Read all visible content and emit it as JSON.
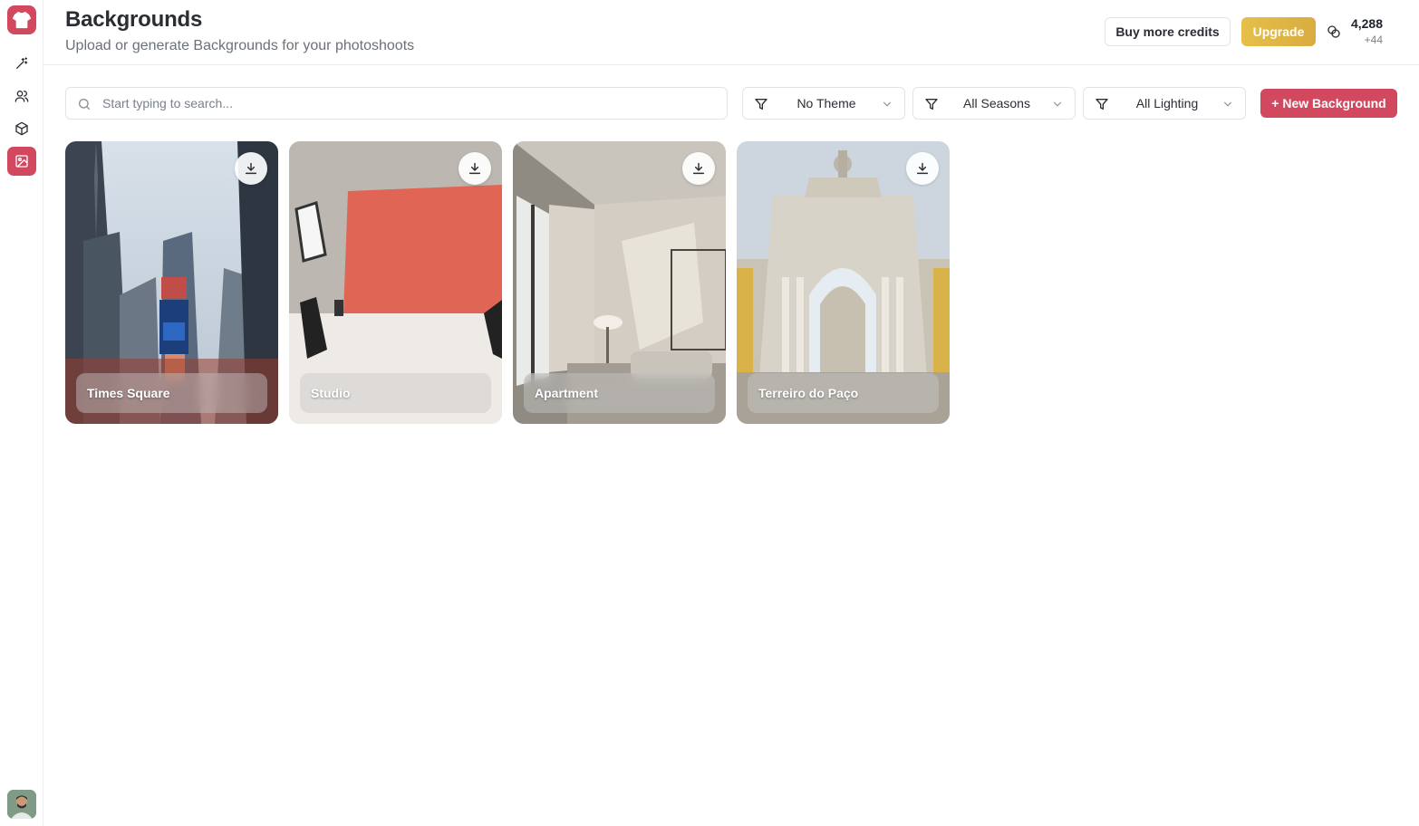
{
  "sidebar": {
    "logo": "shirt-logo-icon",
    "items": [
      {
        "icon": "magic-wand-icon",
        "active": false
      },
      {
        "icon": "users-icon",
        "active": false
      },
      {
        "icon": "box-icon",
        "active": false
      },
      {
        "icon": "image-icon",
        "active": true
      }
    ],
    "avatar": "user-avatar"
  },
  "header": {
    "title": "Backgrounds",
    "subtitle": "Upload or generate Backgrounds for your photoshoots",
    "buy_credits_label": "Buy more credits",
    "upgrade_label": "Upgrade",
    "credits_total": "4,288",
    "credits_delta": "+44"
  },
  "toolbar": {
    "search_placeholder": "Start typing to search...",
    "search_value": "",
    "filters": [
      {
        "icon": "filter-icon",
        "label": "No Theme"
      },
      {
        "icon": "filter-icon",
        "label": "All Seasons"
      },
      {
        "icon": "filter-icon",
        "label": "All Lighting"
      }
    ],
    "new_background_label": "+ New Background"
  },
  "backgrounds": [
    {
      "name": "Times Square",
      "scene": "city-street"
    },
    {
      "name": "Studio",
      "scene": "photo-studio"
    },
    {
      "name": "Apartment",
      "scene": "living-room"
    },
    {
      "name": "Terreiro do Paço",
      "scene": "triumphal-arch"
    }
  ],
  "colors": {
    "brand": "#d1485f",
    "upgrade": "#dcb043",
    "border": "#e3e3e3",
    "muted_text": "#6b7079"
  }
}
